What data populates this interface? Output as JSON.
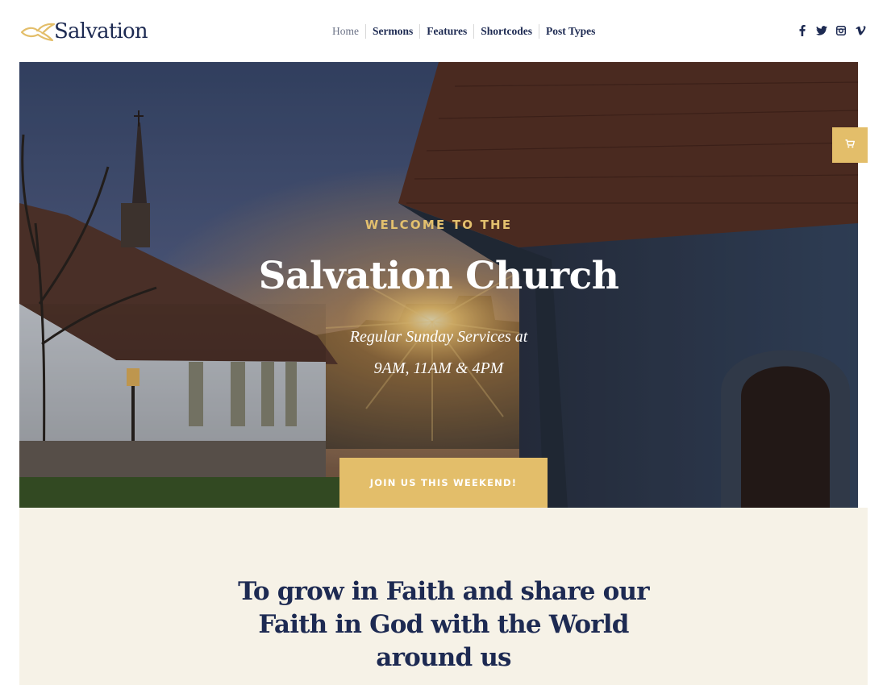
{
  "header": {
    "logo_text": "Salvation",
    "nav": [
      {
        "label": "Home"
      },
      {
        "label": "Sermons"
      },
      {
        "label": "Features"
      },
      {
        "label": "Shortcodes"
      },
      {
        "label": "Post Types"
      }
    ],
    "social": [
      {
        "icon": "facebook-icon",
        "glyph": "f"
      },
      {
        "icon": "twitter-icon"
      },
      {
        "icon": "instagram-icon"
      },
      {
        "icon": "vimeo-icon",
        "glyph": "v"
      }
    ]
  },
  "hero": {
    "eyebrow": "WELCOME TO THE",
    "title": "Salvation Church",
    "subtitle_line1": "Regular Sunday Services at",
    "subtitle_line2": "9AM, 11AM & 4PM",
    "cta_label": "JOIN US THIS WEEKEND!"
  },
  "cart": {
    "icon": "cart-icon"
  },
  "mission": {
    "text": "To grow in Faith and share our Faith in God with the World around us"
  },
  "colors": {
    "brand_navy": "#1d2a52",
    "accent_gold": "#e3be6a",
    "cream_background": "#f6f2e7"
  }
}
